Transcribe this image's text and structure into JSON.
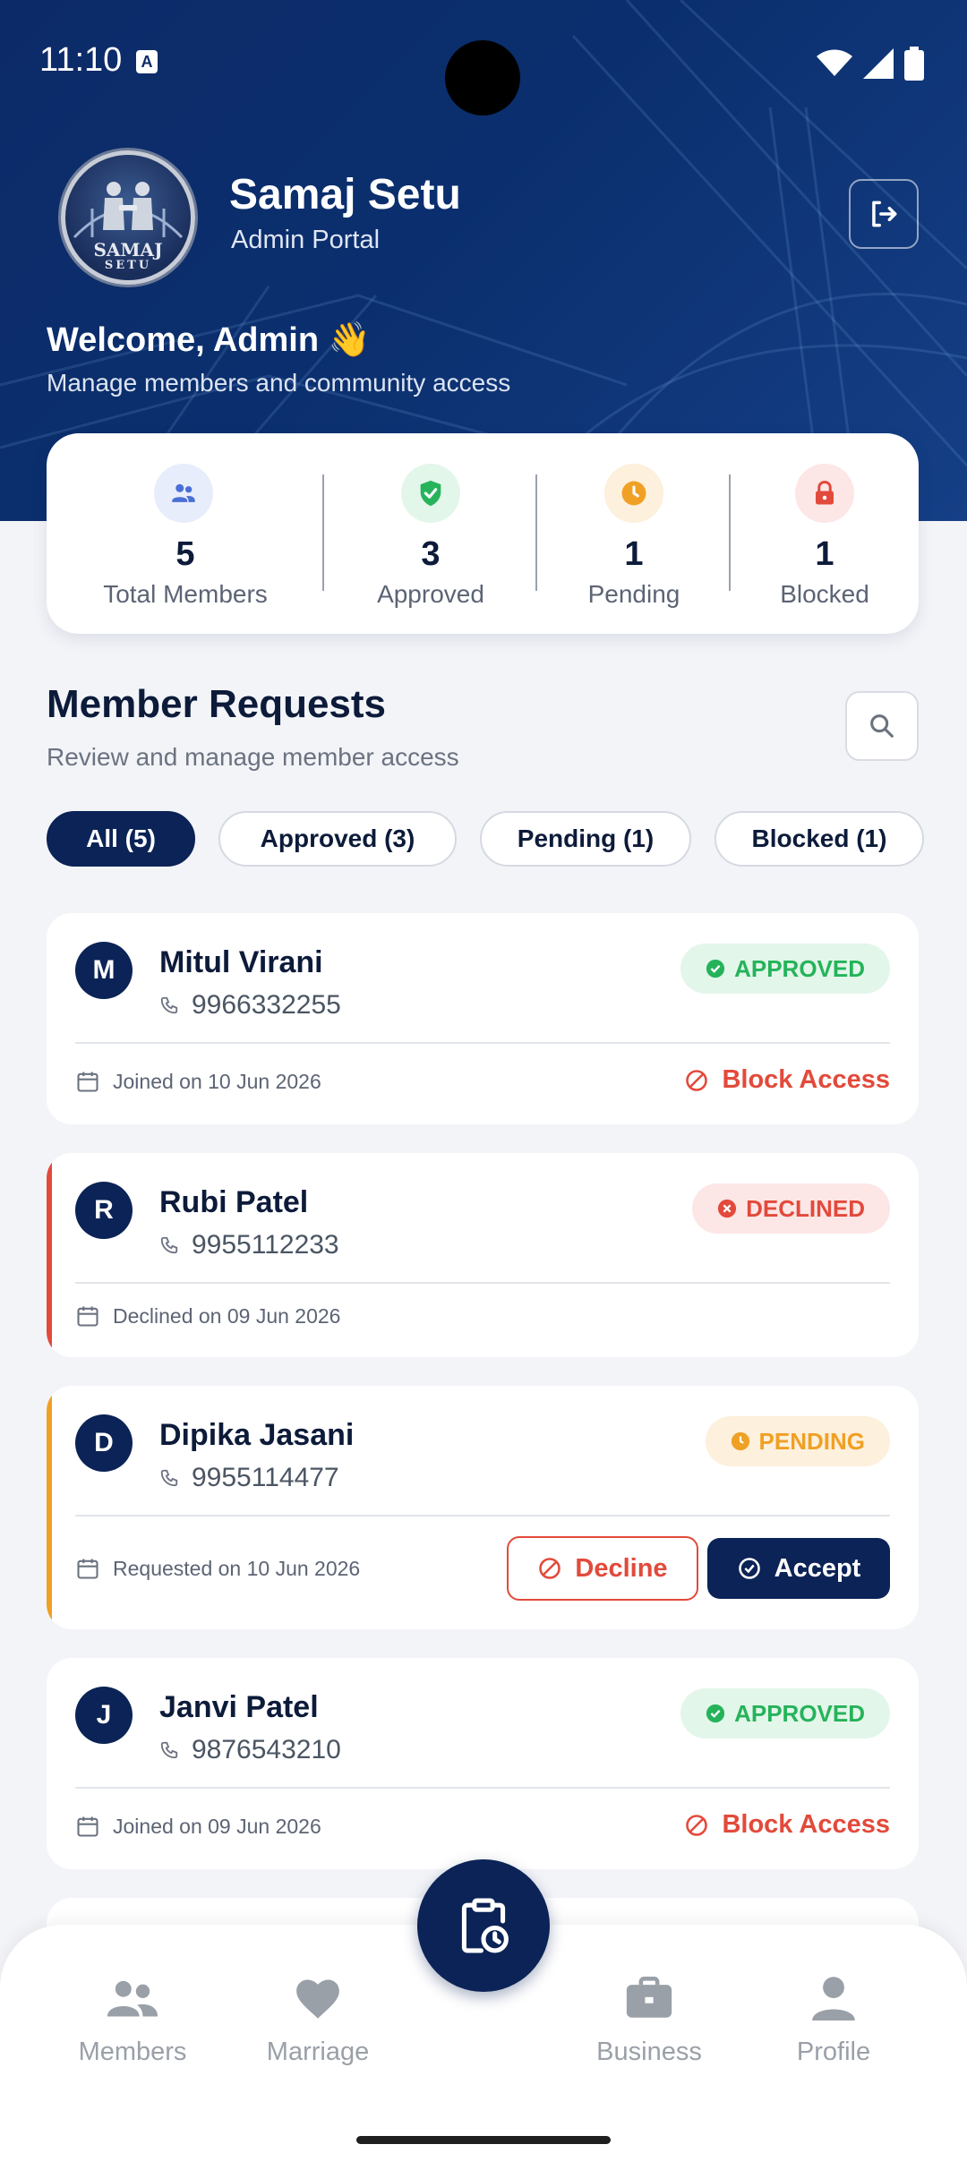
{
  "status_bar": {
    "time": "11:10",
    "notification_icon": "A"
  },
  "app": {
    "title": "Samaj Setu",
    "subtitle": "Admin Portal",
    "logo_text_top": "SAMAJ",
    "logo_text_bottom": "SETU"
  },
  "welcome": {
    "title": "Welcome, Admin 👋",
    "subtitle": "Manage members and community access"
  },
  "stats": [
    {
      "value": "5",
      "label": "Total Members",
      "icon": "people-icon",
      "color": "#4a6fd6",
      "bg": "#e8edfb"
    },
    {
      "value": "3",
      "label": "Approved",
      "icon": "verified-shield-icon",
      "color": "#27b35c",
      "bg": "#e3f6ea"
    },
    {
      "value": "1",
      "label": "Pending",
      "icon": "clock-icon",
      "color": "#f0a024",
      "bg": "#fdf0dc"
    },
    {
      "value": "1",
      "label": "Blocked",
      "icon": "lock-icon",
      "color": "#e24a3b",
      "bg": "#fde6e6"
    }
  ],
  "requests": {
    "title": "Member Requests",
    "subtitle": "Review and manage member access",
    "filters": [
      "All (5)",
      "Approved (3)",
      "Pending (1)",
      "Blocked (1)"
    ],
    "active_filter": "All (5)"
  },
  "members": [
    {
      "initial": "M",
      "name": "Mitul Virani",
      "phone": "9966332255",
      "status": "APPROVED",
      "date_text": "Joined on 10 Jun 2026",
      "action": "Block Access"
    },
    {
      "initial": "R",
      "name": "Rubi Patel",
      "phone": "9955112233",
      "status": "DECLINED",
      "date_text": "Declined on 09 Jun 2026"
    },
    {
      "initial": "D",
      "name": "Dipika Jasani",
      "phone": "9955114477",
      "status": "PENDING",
      "date_text": "Requested on 10 Jun 2026",
      "decline_label": "Decline",
      "accept_label": "Accept"
    },
    {
      "initial": "J",
      "name": "Janvi Patel",
      "phone": "9876543210",
      "status": "APPROVED",
      "date_text": "Joined on 09 Jun 2026",
      "action": "Block Access"
    }
  ],
  "nav": {
    "items": [
      "Members",
      "Marriage",
      "Business",
      "Profile"
    ]
  },
  "colors": {
    "primary": "#0b2356",
    "approved": "#25b35a",
    "declined": "#e24a3b",
    "pending": "#f0a024"
  }
}
